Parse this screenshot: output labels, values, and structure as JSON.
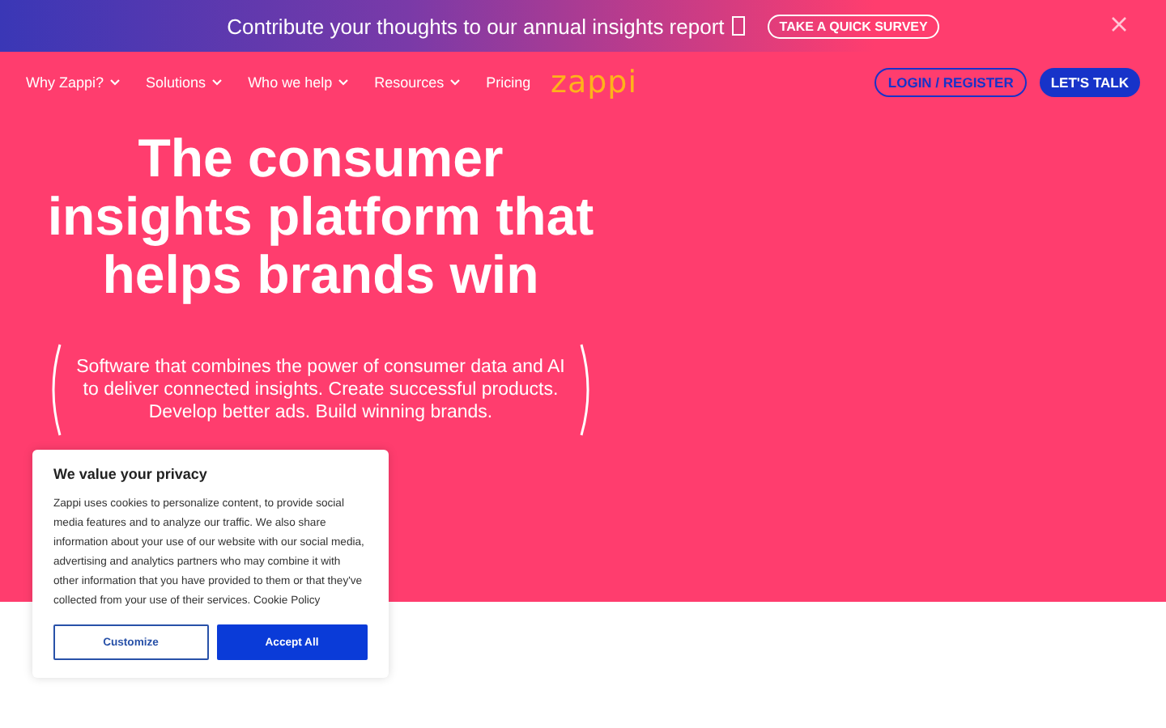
{
  "banner": {
    "text": "Contribute your thoughts to our annual insights report",
    "button": "TAKE A QUICK SURVEY"
  },
  "nav": {
    "items": [
      {
        "label": "Why Zappi?",
        "dropdown": true
      },
      {
        "label": "Solutions",
        "dropdown": true
      },
      {
        "label": "Who we help",
        "dropdown": true
      },
      {
        "label": "Resources",
        "dropdown": true
      },
      {
        "label": "Pricing",
        "dropdown": false
      }
    ],
    "logo": "zappi",
    "login": "LOGIN / REGISTER",
    "cta": "LET'S TALK"
  },
  "hero": {
    "title": "The consumer insights platform that helps brands win",
    "subtitle": "Software that combines the power of consumer data and AI to deliver connected insights. Create successful products. Develop better ads. Build winning brands."
  },
  "cookie": {
    "title": "We value your privacy",
    "body": "Zappi uses cookies to personalize content, to provide social media features and to analyze our traffic. We also share information about your use of our website with our social media, advertising and analytics partners who may combine it with other information that you have provided to them or that they've collected from your use of their services. Cookie Policy",
    "buttons": [
      "Customize",
      "Accept All"
    ]
  }
}
